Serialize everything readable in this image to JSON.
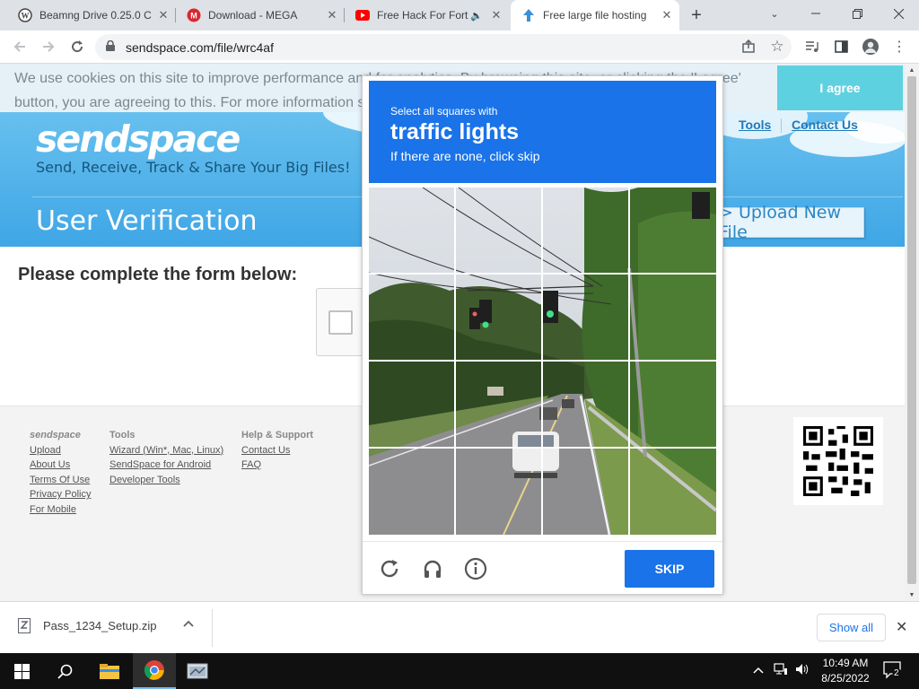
{
  "browser": {
    "tabs": [
      {
        "title": "Beamng Drive 0.25.0 C",
        "icon": "wordpress-icon",
        "active": false
      },
      {
        "title": "Download - MEGA",
        "icon": "mega-icon",
        "active": false
      },
      {
        "title": "Free Hack For Fort",
        "icon": "youtube-icon",
        "active": false
      },
      {
        "title": "Free large file hosting",
        "icon": "sendspace-icon",
        "active": true
      }
    ],
    "url": "sendspace.com/file/wrc4af"
  },
  "cookie": {
    "text": "We use cookies on this site to improve performance and for analytics. By browsing this site, or clicking the 'I agree' button, you are agreeing to this. For more information s",
    "agree_label": "I agree"
  },
  "site": {
    "logo": "sendspace",
    "tagline": "Send, Receive, Track & Share Your Big Files!",
    "page_title": "User Verification",
    "nav": [
      "Tools",
      "Contact Us"
    ],
    "upload_label": "> Upload New File",
    "form_heading": "Please complete the form below:"
  },
  "captcha": {
    "instruction": "Select all squares with",
    "target": "traffic lights",
    "sub": "If there are none, click skip",
    "skip_label": "SKIP",
    "head_color": "#1a73e8"
  },
  "footer": {
    "columns": [
      {
        "head": "sendspace",
        "links": [
          "Upload",
          "About Us",
          "Terms Of Use",
          "Privacy Policy",
          "For Mobile"
        ]
      },
      {
        "head": "Tools",
        "links": [
          "Wizard (Win*, Mac, Linux)",
          "SendSpace for Android",
          "Developer Tools"
        ]
      },
      {
        "head": "Help & Support",
        "links": [
          "Contact Us",
          "FAQ"
        ]
      }
    ]
  },
  "downloads": {
    "file": "Pass_1234_Setup.zip",
    "show_all_label": "Show all"
  },
  "taskbar": {
    "time": "10:49 AM",
    "date": "8/25/2022",
    "notifications": "2"
  }
}
